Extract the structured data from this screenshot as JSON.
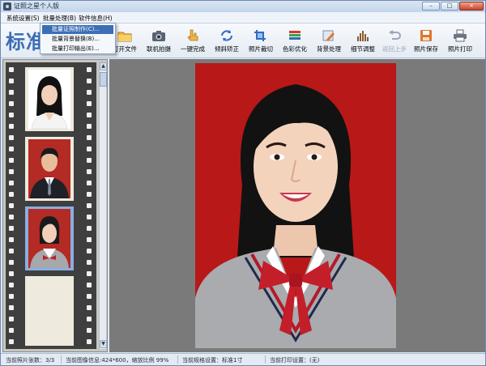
{
  "window": {
    "title": "证照之星个人版",
    "controls": {
      "minimize": "–",
      "maximize": "□",
      "close": "×"
    }
  },
  "menu": {
    "items": [
      "系统设置(S)",
      "批量处理(B)",
      "软件信息(H)"
    ],
    "open_dropdown": [
      "批量证照制作(C)...",
      "批量背景替换(B)...",
      "批量打印输出(E)..."
    ],
    "selected_index": 0
  },
  "toolbar": {
    "brand": "标准",
    "tools": [
      {
        "label": "打开文件",
        "icon": "folder-icon",
        "enabled": true
      },
      {
        "label": "联机拍摄",
        "icon": "camera-icon",
        "enabled": true
      },
      {
        "label": "一键完成",
        "icon": "hand-click-icon",
        "enabled": true
      },
      {
        "label": "倾斜矫正",
        "icon": "rotate-correct-icon",
        "enabled": true
      },
      {
        "label": "照片裁切",
        "icon": "crop-icon",
        "enabled": true
      },
      {
        "label": "色彩优化",
        "icon": "color-bars-icon",
        "enabled": true
      },
      {
        "label": "背景处理",
        "icon": "background-brush-icon",
        "enabled": true
      },
      {
        "label": "细节调整",
        "icon": "levels-chart-icon",
        "enabled": true
      },
      {
        "label": "返回上步",
        "icon": "undo-arrow-icon",
        "enabled": false
      },
      {
        "label": "照片保存",
        "icon": "save-disk-icon",
        "enabled": true
      },
      {
        "label": "照片打印",
        "icon": "printer-icon",
        "enabled": true
      }
    ]
  },
  "thumbnails": {
    "count": 3,
    "selected_index": 2,
    "backgrounds": [
      "#ffffff",
      "#b42a24",
      "#b42a24"
    ]
  },
  "colors": {
    "photo_background": "#b81818",
    "brand": "#3b6db3",
    "selection": "#3d6fb7"
  },
  "status": {
    "photo_count": "当前照片张数：3/3",
    "image_info": "当前图像信息:424*600，缩放比例 99%",
    "spec": "当前规格设置：标准1寸",
    "print": "当前打印设置：(无)"
  }
}
